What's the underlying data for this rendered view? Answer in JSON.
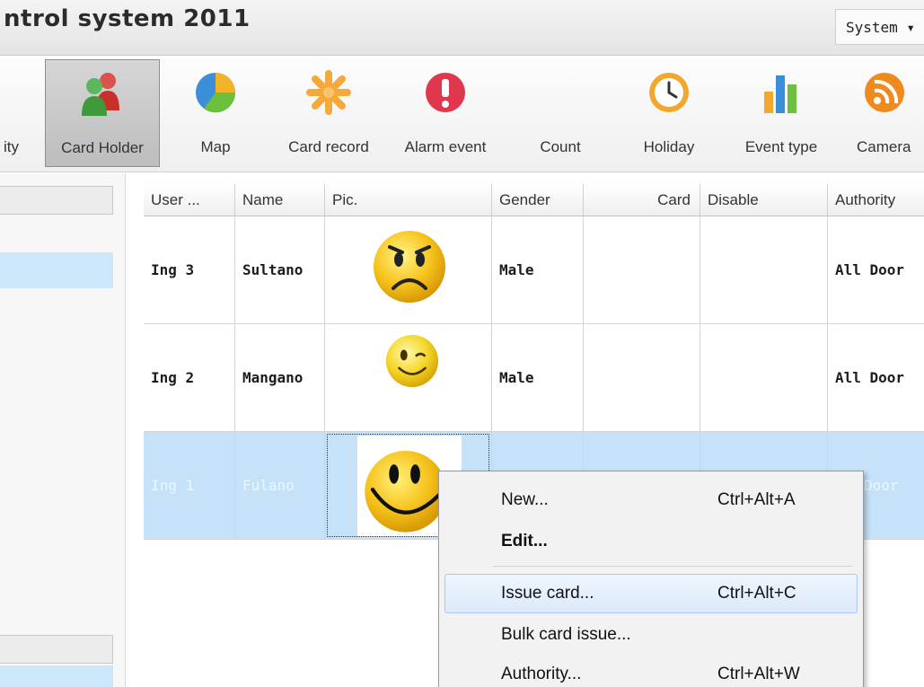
{
  "window": {
    "title": "ntrol system 2011",
    "system_menu": "System ▾"
  },
  "toolbar": {
    "items": [
      {
        "label": "ity",
        "icon": "partial-icon"
      },
      {
        "label": "Card Holder",
        "icon": "people-icon",
        "active": true
      },
      {
        "label": "Map",
        "icon": "pie-map-icon"
      },
      {
        "label": "Card record",
        "icon": "asterisk-icon"
      },
      {
        "label": "Alarm event",
        "icon": "alert-icon"
      },
      {
        "label": "Count",
        "icon": "none"
      },
      {
        "label": "Holiday",
        "icon": "clock-icon"
      },
      {
        "label": "Event type",
        "icon": "bar-chart-icon"
      },
      {
        "label": "Camera",
        "icon": "rss-icon"
      }
    ]
  },
  "grid": {
    "columns": [
      "User ...",
      "Name",
      "Pic.",
      "Gender",
      "Card",
      "Disable",
      "Authority"
    ],
    "rows": [
      {
        "user": "Ing 3",
        "name": "Sultano",
        "pic": "sad-face-icon",
        "gender": "Male",
        "card": "",
        "disable": "",
        "authority": "All Door"
      },
      {
        "user": "Ing 2",
        "name": "Mangano",
        "pic": "wink-face-icon",
        "gender": "Male",
        "card": "",
        "disable": "",
        "authority": "All Door"
      },
      {
        "user": "Ing 1",
        "name": "Fulano",
        "pic": "smile-face-icon",
        "gender": "",
        "card": "",
        "disable": "",
        "authority": "Door",
        "selected": true
      }
    ]
  },
  "context_menu": {
    "items": [
      {
        "label": "New...",
        "shortcut": "Ctrl+Alt+A"
      },
      {
        "label": "Edit...",
        "shortcut": "",
        "bold": true
      },
      {
        "label": "Issue card...",
        "shortcut": "Ctrl+Alt+C",
        "highlighted": true
      },
      {
        "label": "Bulk card issue...",
        "shortcut": ""
      },
      {
        "label": "Authority...",
        "shortcut": "Ctrl+Alt+W"
      }
    ]
  }
}
